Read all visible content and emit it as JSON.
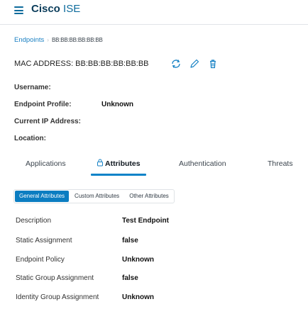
{
  "header": {
    "menu_icon": "hamburger-icon",
    "brand_bold": "Cisco",
    "brand_rest": " ISE",
    "accent": "#0d6b9c"
  },
  "breadcrumb": {
    "parent": "Endpoints",
    "current": "BB:BB:BB:BB:BB:BB"
  },
  "endpoint": {
    "mac_text": "MAC ADDRESS: BB:BB:BB:BB:BB:BB",
    "action_icons": [
      "refresh-icon",
      "edit-pencil-icon",
      "trash-icon"
    ],
    "fields": [
      {
        "label": "Username:",
        "value": ""
      },
      {
        "label": "Endpoint Profile:",
        "value": "Unknown"
      },
      {
        "label": "Current IP Address:",
        "value": ""
      },
      {
        "label": "Location:",
        "value": ""
      }
    ]
  },
  "tabs": [
    {
      "label": "Applications",
      "active": false
    },
    {
      "label": "Attributes",
      "active": true,
      "icon": "lock-icon"
    },
    {
      "label": "Authentication",
      "active": false
    },
    {
      "label": "Threats",
      "active": false
    }
  ],
  "subtabs": [
    {
      "label": "General Attributes",
      "active": true
    },
    {
      "label": "Custom Attributes",
      "active": false
    },
    {
      "label": "Other Attributes",
      "active": false
    }
  ],
  "attributes": [
    {
      "label": "Description",
      "value": "Test Endpoint"
    },
    {
      "label": "Static Assignment",
      "value": "false"
    },
    {
      "label": "Endpoint Policy",
      "value": "Unknown"
    },
    {
      "label": "Static Group Assignment",
      "value": "false"
    },
    {
      "label": "Identity Group Assignment",
      "value": "Unknown"
    }
  ]
}
